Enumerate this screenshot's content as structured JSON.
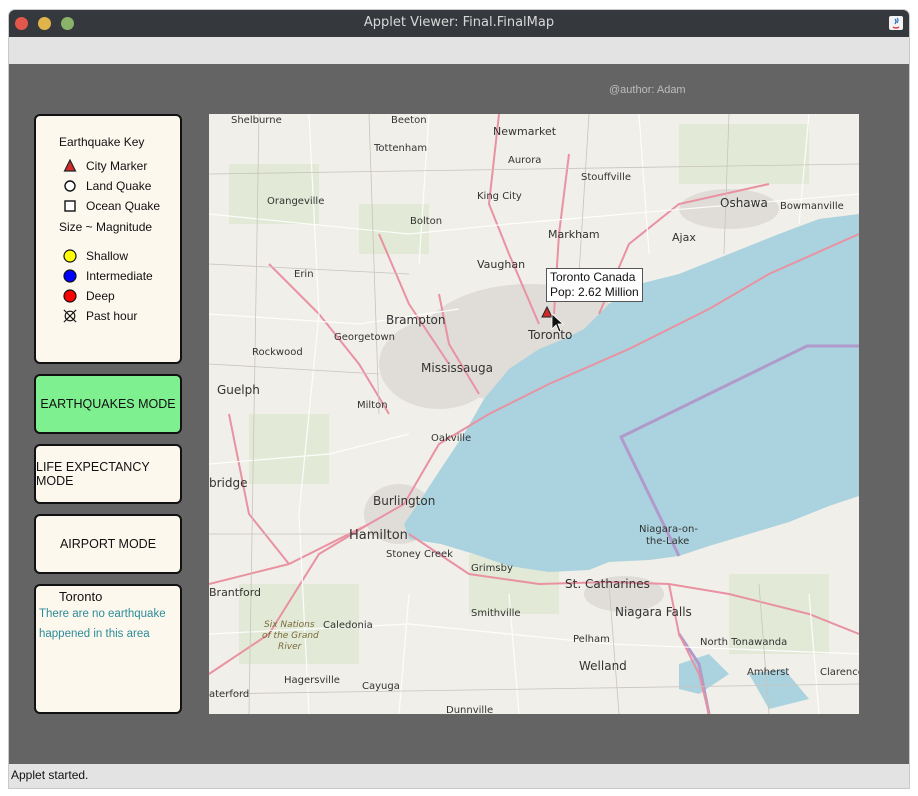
{
  "window": {
    "title": "Applet Viewer: Final.FinalMap"
  },
  "applet": {
    "author": "@author: Adam",
    "status": "Applet started."
  },
  "key": {
    "title": "Earthquake Key",
    "items": [
      {
        "label": "City Marker",
        "icon": "red-triangle-icon"
      },
      {
        "label": "Land Quake",
        "icon": "circle-outline-icon"
      },
      {
        "label": "Ocean Quake",
        "icon": "square-outline-icon"
      }
    ],
    "size_label": "Size ~ Magnitude",
    "depth_items": [
      {
        "label": "Shallow",
        "color": "#ffff00"
      },
      {
        "label": "Intermediate",
        "color": "#0000ff"
      },
      {
        "label": "Deep",
        "color": "#ff0000"
      },
      {
        "label": "Past hour",
        "icon": "crossed-circle-icon"
      }
    ]
  },
  "modes": {
    "earthquakes": "EARTHQUAKES MODE",
    "life_expectancy": "LIFE EXPECTANCY MODE",
    "airport": "AIRPORT MODE",
    "active": "earthquakes",
    "active_color": "#7ef08f"
  },
  "info": {
    "city": "Toronto",
    "message": "There are no earthquake happened in this area"
  },
  "map": {
    "labels": {
      "shelburne": "Shelburne",
      "beeton": "Beeton",
      "newmarket": "Newmarket",
      "tottenham": "Tottenham",
      "aurora": "Aurora",
      "stouffville": "Stouffville",
      "orangeville": "Orangeville",
      "king_city": "King City",
      "oshawa": "Oshawa",
      "bowmanville": "Bowmanville",
      "bolton": "Bolton",
      "markham": "Markham",
      "ajax": "Ajax",
      "erin": "Erin",
      "vaughan": "Vaughan",
      "brampton": "Brampton",
      "georgetown": "Georgetown",
      "toronto": "Toronto",
      "rockwood": "Rockwood",
      "mississauga": "Mississauga",
      "guelph": "Guelph",
      "milton": "Milton",
      "oakville": "Oakville",
      "bridge": "bridge",
      "burlington": "Burlington",
      "hamilton": "Hamilton",
      "stoney_creek": "Stoney Creek",
      "grimsby": "Grimsby",
      "niagara_on": "Niagara-on-",
      "the_lake": "the-Lake",
      "st_catharines": "St. Catharines",
      "brantford": "Brantford",
      "caledonia": "Caledonia",
      "smithville": "Smithville",
      "niagara_falls": "Niagara Falls",
      "six_nations_1": "Six Nations",
      "six_nations_2": "of the Grand",
      "six_nations_3": "River",
      "pelham": "Pelham",
      "north_tonawanda": "North Tonawanda",
      "welland": "Welland",
      "hagersville": "Hagersville",
      "cayuga": "Cayuga",
      "amherst": "Amherst",
      "clarence": "Clarence",
      "waterford": "aterford",
      "dunnville": "Dunnville"
    },
    "tooltip": {
      "line1": "Toronto Canada",
      "line2": "Pop: 2.62 Million"
    },
    "colors": {
      "land": "#f1efe9",
      "lake": "#aad3df",
      "highway": "#e892a2",
      "border": "#b09acb"
    }
  }
}
